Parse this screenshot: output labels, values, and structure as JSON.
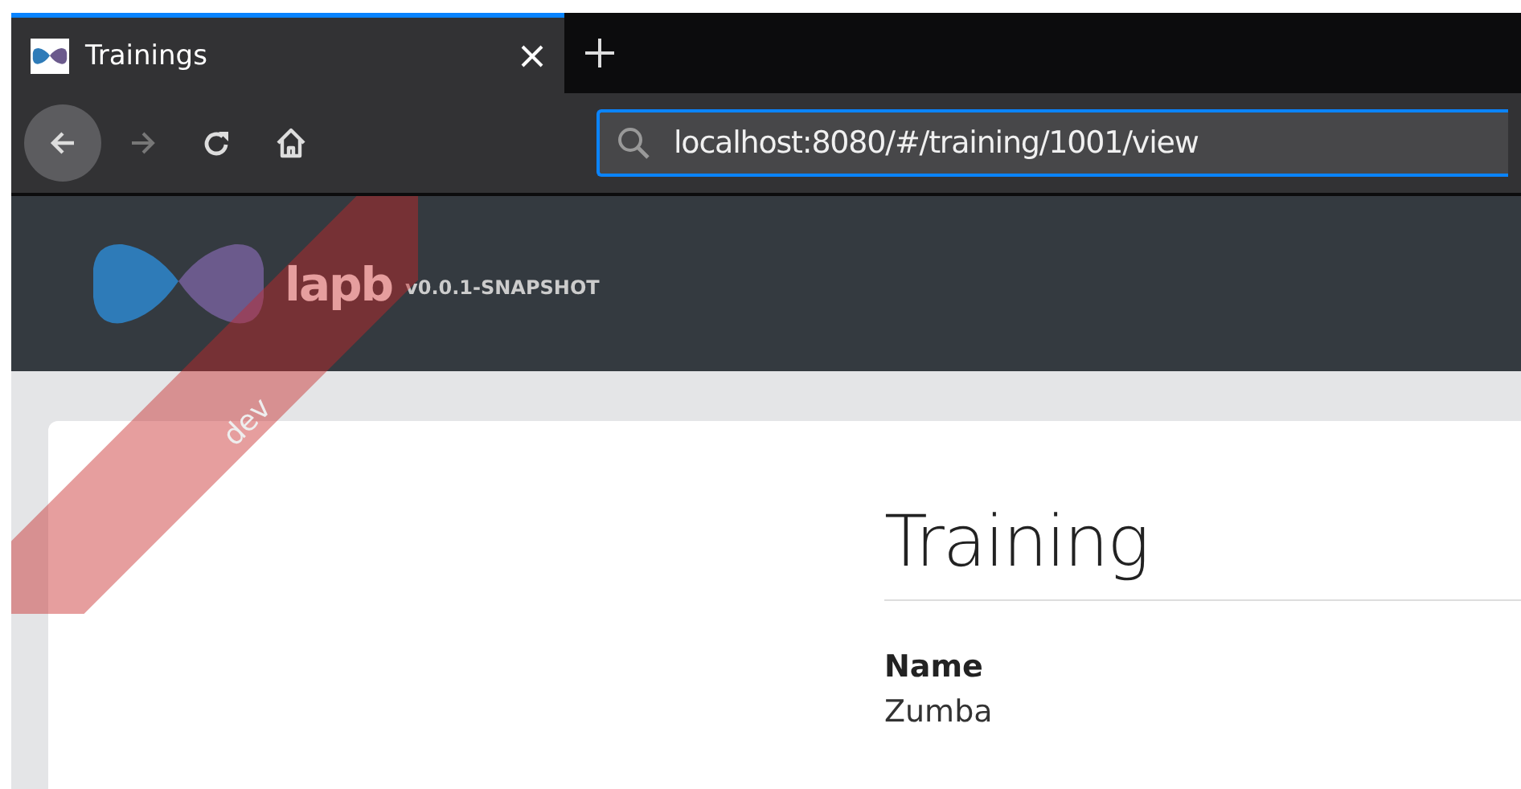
{
  "browser": {
    "tabs": [
      {
        "title": "Trainings",
        "selected": true
      }
    ],
    "navigation": [
      {
        "kind": "back",
        "disabled": false
      },
      {
        "kind": "forward",
        "disabled": true
      },
      {
        "kind": "reload",
        "disabled": false
      },
      {
        "kind": "home",
        "disabled": false
      }
    ],
    "address_bar": {
      "value": "localhost:8080/#/training/1001/view"
    }
  },
  "navbar": {
    "brand": "lapb",
    "version": "v0.0.1-SNAPSHOT",
    "ribbon": "dev"
  },
  "page": {
    "heading": "Training",
    "fields": [
      {
        "label": "Name",
        "value": "Zumba"
      }
    ]
  }
}
